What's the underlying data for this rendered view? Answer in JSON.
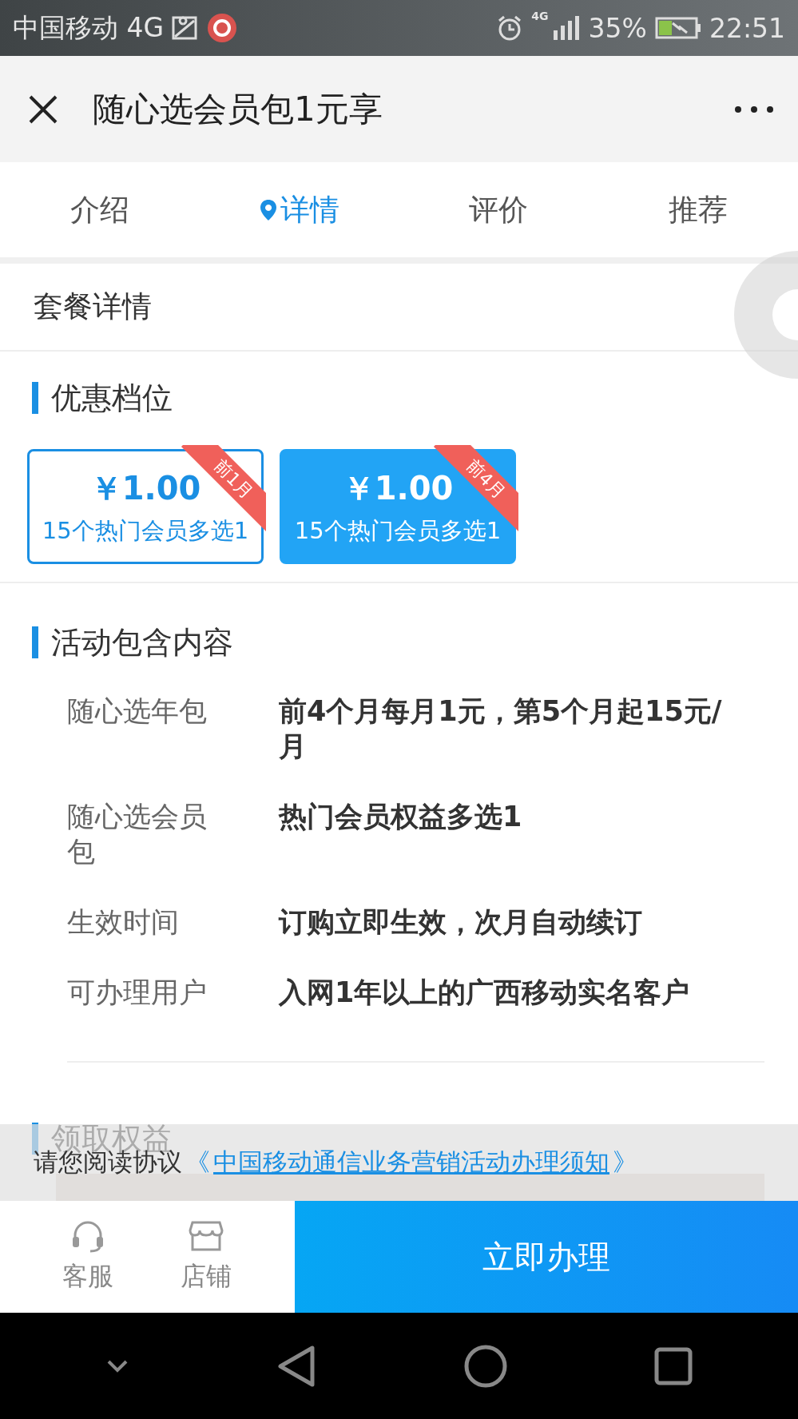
{
  "status_bar": {
    "carrier": "中国移动 4G",
    "network": "4G",
    "battery": "35%",
    "time": "22:51"
  },
  "header": {
    "title": "随心选会员包1元享"
  },
  "tabs": [
    {
      "label": "介绍",
      "selected": false
    },
    {
      "label": "详情",
      "selected": true
    },
    {
      "label": "评价",
      "selected": false
    },
    {
      "label": "推荐",
      "selected": false
    }
  ],
  "package_title": "套餐详情",
  "tiers": {
    "heading": "优惠档位",
    "items": [
      {
        "price": "￥1.00",
        "description": "15个热门会员多选1",
        "ribbon": "前1月",
        "selected": false
      },
      {
        "price": "￥1.00",
        "description": "15个热门会员多选1",
        "ribbon": "前4月",
        "selected": true
      }
    ]
  },
  "contents": {
    "heading": "活动包含内容",
    "rows": [
      {
        "label": "随心选年包",
        "value": "前4个月每月1元，第5个月起15元/月"
      },
      {
        "label": "随心选会员包",
        "value": "热门会员权益多选1"
      },
      {
        "label": "生效时间",
        "value": "订购立即生效，次月自动续订"
      },
      {
        "label": "可办理用户",
        "value": "入网1年以上的广西移动实名客户"
      }
    ]
  },
  "benefits": {
    "heading": "领取权益"
  },
  "agreement": {
    "prefix": "请您阅读协议",
    "open": "《",
    "link": "中国移动通信业务营销活动办理须知",
    "close": "》"
  },
  "bottom_bar": {
    "actions": [
      {
        "label": "客服",
        "kind": "headset"
      },
      {
        "label": "店铺",
        "kind": "store"
      }
    ],
    "submit": "立即办理"
  }
}
